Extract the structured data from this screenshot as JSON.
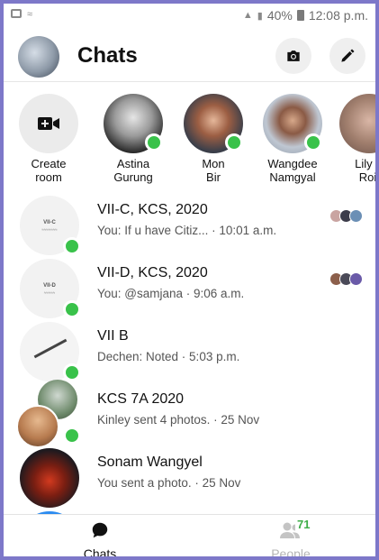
{
  "status_bar": {
    "battery": "40%",
    "time": "12:08 p.m."
  },
  "header": {
    "title": "Chats"
  },
  "stories": [
    {
      "name": "Create\nroom",
      "kind": "create"
    },
    {
      "name": "Astina\nGurung",
      "online": true
    },
    {
      "name": "Mon\nBir",
      "online": true
    },
    {
      "name": "Wangdee\nNamgyal",
      "online": true
    },
    {
      "name": "Lily K\nRoii",
      "online": false
    }
  ],
  "chats": [
    {
      "name": "VII-C, KCS, 2020",
      "preview": "You: If u have Citiz... · 10:01 a.m.",
      "avatar_text": "VII-C",
      "online": true
    },
    {
      "name": "VII-D, KCS, 2020",
      "preview": "You: @samjana · 9:06 a.m.",
      "avatar_text": "VII-D",
      "online": true
    },
    {
      "name": "VII B",
      "preview": "Dechen: Noted · 5:03 p.m.",
      "online": true
    },
    {
      "name": "KCS 7A 2020",
      "preview": "Kinley sent 4 photos. · 25 Nov",
      "online": true
    },
    {
      "name": "Sonam Wangyel",
      "preview": "You sent a photo. · 25 Nov",
      "online": false
    }
  ],
  "bottom_nav": {
    "chats_label": "Chats",
    "people_label": "People",
    "people_badge": "71"
  },
  "colors": {
    "online": "#39c24a",
    "frame": "#7d78c9",
    "inactive_tab": "#b5b5b5"
  }
}
